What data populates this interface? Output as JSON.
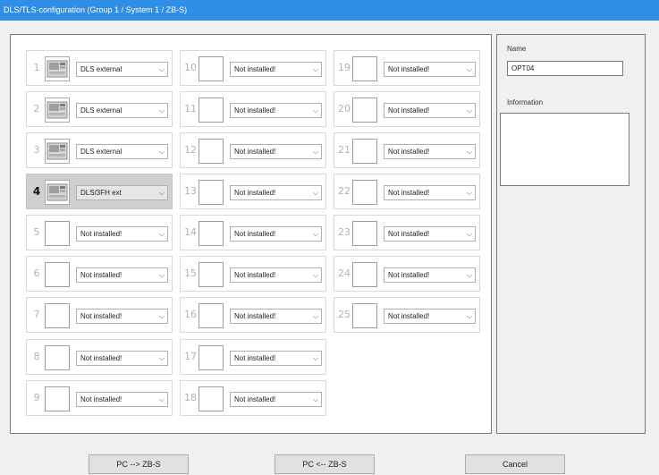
{
  "window": {
    "title": "DLS/TLS-configuration (Group 1 / System 1 / ZB-S)"
  },
  "slots": [
    {
      "number": "1",
      "value": "DLS external",
      "has_device": true,
      "selected": false
    },
    {
      "number": "2",
      "value": "DLS external",
      "has_device": true,
      "selected": false
    },
    {
      "number": "3",
      "value": "DLS external",
      "has_device": true,
      "selected": false
    },
    {
      "number": "4",
      "value": "DLS/3FH ext",
      "has_device": true,
      "selected": true
    },
    {
      "number": "5",
      "value": "Not installed!",
      "has_device": false,
      "selected": false
    },
    {
      "number": "6",
      "value": "Not installed!",
      "has_device": false,
      "selected": false
    },
    {
      "number": "7",
      "value": "Not installed!",
      "has_device": false,
      "selected": false
    },
    {
      "number": "8",
      "value": "Not installed!",
      "has_device": false,
      "selected": false
    },
    {
      "number": "9",
      "value": "Not installed!",
      "has_device": false,
      "selected": false
    },
    {
      "number": "10",
      "value": "Not installed!",
      "has_device": false,
      "selected": false
    },
    {
      "number": "11",
      "value": "Not installed!",
      "has_device": false,
      "selected": false
    },
    {
      "number": "12",
      "value": "Not installed!",
      "has_device": false,
      "selected": false
    },
    {
      "number": "13",
      "value": "Not installed!",
      "has_device": false,
      "selected": false
    },
    {
      "number": "14",
      "value": "Not installed!",
      "has_device": false,
      "selected": false
    },
    {
      "number": "15",
      "value": "Not installed!",
      "has_device": false,
      "selected": false
    },
    {
      "number": "16",
      "value": "Not installed!",
      "has_device": false,
      "selected": false
    },
    {
      "number": "17",
      "value": "Not installed!",
      "has_device": false,
      "selected": false
    },
    {
      "number": "18",
      "value": "Not installed!",
      "has_device": false,
      "selected": false
    },
    {
      "number": "19",
      "value": "Not installed!",
      "has_device": false,
      "selected": false
    },
    {
      "number": "20",
      "value": "Not installed!",
      "has_device": false,
      "selected": false
    },
    {
      "number": "21",
      "value": "Not installed!",
      "has_device": false,
      "selected": false
    },
    {
      "number": "22",
      "value": "Not installed!",
      "has_device": false,
      "selected": false
    },
    {
      "number": "23",
      "value": "Not installed!",
      "has_device": false,
      "selected": false
    },
    {
      "number": "24",
      "value": "Not installed!",
      "has_device": false,
      "selected": false
    },
    {
      "number": "25",
      "value": "Not installed!",
      "has_device": false,
      "selected": false
    }
  ],
  "details": {
    "name_label": "Name",
    "name_value": "OPT04",
    "information_label": "Information",
    "information_value": ""
  },
  "buttons": {
    "pc_to_zbs": "PC --> ZB-S",
    "zbs_to_pc": "PC <-- ZB-S",
    "cancel": "Cancel"
  },
  "colors": {
    "titlebar": "#2f8ee6",
    "selected_slot": "#cfcfcf"
  },
  "icons": {
    "dropdown": "chevron-down-icon",
    "device": "dls-device-icon"
  }
}
